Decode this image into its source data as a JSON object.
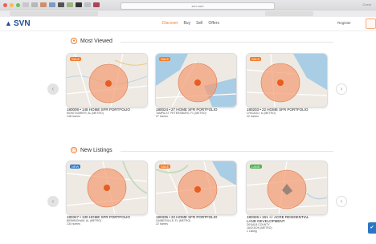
{
  "browser": {
    "url": "svn.com",
    "right_label": "Guest"
  },
  "brand": {
    "logo_text": "SVN"
  },
  "nav": {
    "items": [
      "Discover",
      "Buy",
      "Sell",
      "Offers"
    ],
    "register_label": "Register"
  },
  "sections": [
    {
      "title": "Most Viewed",
      "icon": "eye-icon",
      "cards": [
        {
          "badge": "SALE",
          "title": "180008 • 148 HOME SFR PORTFOLIO",
          "lines": [
            "MONTGOMERY, AL (METRO)",
            "148 homes"
          ]
        },
        {
          "badge": "SALE",
          "title": "180024 • 27 HOME SFR PORTFOLIO",
          "lines": [
            "TAMPA-ST. PETERSBURG, FL (METRO)",
            "27 homes"
          ]
        },
        {
          "badge": "SALE",
          "title": "180203 • 22 HOME SFR PORTFOLIO",
          "lines": [
            "CHICAGO, IL (METRO)",
            "22 homes"
          ]
        }
      ]
    },
    {
      "title": "New Listings",
      "icon": "clock-icon",
      "cards": [
        {
          "badge": "NEW",
          "title": "180347 • 130 HOME SFR PORTFOLIO",
          "lines": [
            "BIRMINGHAM, AL (METRO)",
            "130 homes"
          ]
        },
        {
          "badge": "SALE",
          "title": "180335 • 22 HOME SFR PORTFOLIO",
          "lines": [
            "GAINESVILLE, FL (METRO)",
            "22 homes"
          ]
        },
        {
          "badge": "LAND",
          "title": "180326 • 161 +/- ACRE RESIDENTIAL",
          "lines": [
            "LAND DEVELOPMENT",
            "DEKALB COUNTY",
            "JACKSON (METRO)",
            "1 Listing"
          ]
        }
      ]
    }
  ],
  "colors": {
    "accent": "#f07b2b",
    "brand": "#1e4c8f",
    "chat": "#2a76c6"
  }
}
